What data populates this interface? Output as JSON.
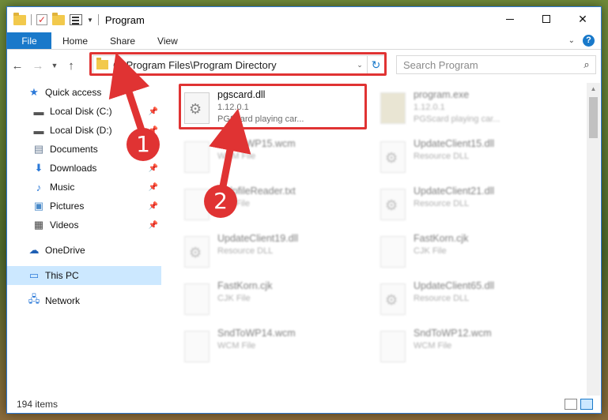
{
  "window": {
    "title": "Program"
  },
  "ribbon": {
    "tabs": [
      "File",
      "Home",
      "Share",
      "View"
    ],
    "help_label": "?"
  },
  "nav": {
    "address_path": "C:\\Program Files\\Program Directory",
    "search_placeholder": "Search Program"
  },
  "sidebar": {
    "items": [
      {
        "label": "Quick access",
        "icon": "star-icon"
      },
      {
        "label": "Local Disk (C:)",
        "icon": "drive-icon"
      },
      {
        "label": "Local Disk (D:)",
        "icon": "drive-icon"
      },
      {
        "label": "Documents",
        "icon": "documents-icon"
      },
      {
        "label": "Downloads",
        "icon": "download-icon"
      },
      {
        "label": "Music",
        "icon": "music-icon"
      },
      {
        "label": "Pictures",
        "icon": "pictures-icon"
      },
      {
        "label": "Videos",
        "icon": "videos-icon"
      },
      {
        "label": "OneDrive",
        "icon": "cloud-icon"
      },
      {
        "label": "This PC",
        "icon": "computer-icon"
      },
      {
        "label": "Network",
        "icon": "network-icon"
      }
    ]
  },
  "files": [
    {
      "name": "pgscard.dll",
      "line2": "1.12.0.1",
      "line3": "PGScard playing car..."
    },
    {
      "name": "program.exe",
      "line2": "1.12.0.1",
      "line3": "PGScard playing car..."
    },
    {
      "name": "SndToWP15.wcm",
      "line2": "WCM File"
    },
    {
      "name": "UpdateClient15.dll",
      "line2": "Resource DLL"
    },
    {
      "name": "HelpfileReader.txt",
      "line2": "Text File"
    },
    {
      "name": "UpdateClient21.dll",
      "line2": "Resource DLL"
    },
    {
      "name": "UpdateClient19.dll",
      "line2": "Resource DLL"
    },
    {
      "name": "FastKorn.cjk",
      "line2": "CJK File"
    },
    {
      "name": "FastKorn.cjk",
      "line2": "CJK File"
    },
    {
      "name": "UpdateClient65.dll",
      "line2": "Resource DLL"
    },
    {
      "name": "SndToWP14.wcm",
      "line2": "WCM File"
    },
    {
      "name": "SndToWP12.wcm",
      "line2": "WCM File"
    }
  ],
  "status": {
    "item_count": "194 items"
  },
  "annotations": {
    "step1": "1",
    "step2": "2",
    "color": "#e03333"
  }
}
